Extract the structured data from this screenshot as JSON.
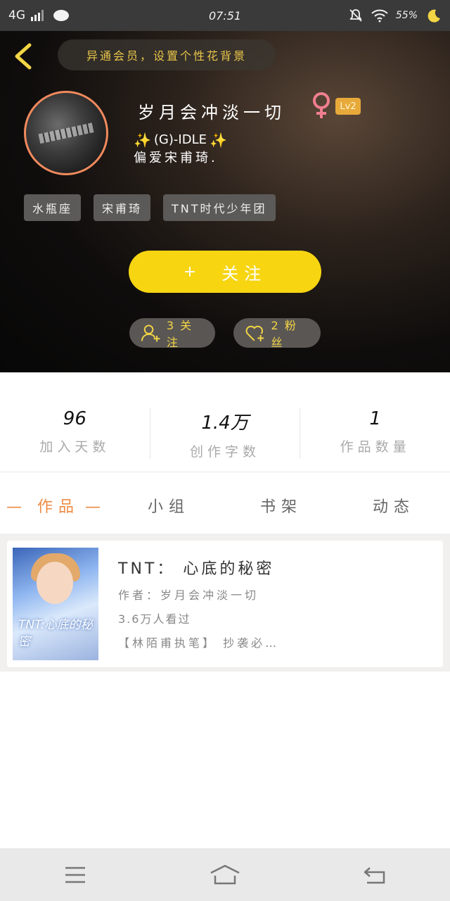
{
  "status_bar": {
    "network": "4G",
    "time": "07:51",
    "battery": "55%"
  },
  "header": {
    "hint": "异通会员，设置个性花背景",
    "nickname": "岁月会冲淡一切",
    "gender_icon": "female-icon",
    "level": "Lv2",
    "bio_line1": "(G)-IDLE",
    "bio_line2": "偏爱宋甫琦."
  },
  "tags": [
    "水瓶座",
    "宋甫琦",
    "TNT时代少年团"
  ],
  "follow_button": {
    "icon": "+",
    "label": "关注"
  },
  "social": {
    "following_label": "3 关注",
    "fans_label": "2 粉丝"
  },
  "stats": [
    {
      "value": "96",
      "label": "加入天数"
    },
    {
      "value": "1.4万",
      "label": "创作字数"
    },
    {
      "value": "1",
      "label": "作品数量"
    }
  ],
  "tabs": [
    {
      "label": "作品",
      "active": true
    },
    {
      "label": "小组",
      "active": false
    },
    {
      "label": "书架",
      "active": false
    },
    {
      "label": "动态",
      "active": false
    }
  ],
  "works": [
    {
      "cover_text": "TNT:心底的秘密",
      "title": "TNT：  心底的秘密",
      "author": "作者：岁月会冲淡一切",
      "views": "3.6万人看过",
      "excerpt": "【林陌甫执笔】  抄袭必…"
    }
  ],
  "colors": {
    "accent_yellow": "#f7d511",
    "tab_active": "#ee8b43",
    "avatar_border": "#f08a5d",
    "level_badge": "#e7a93a"
  }
}
